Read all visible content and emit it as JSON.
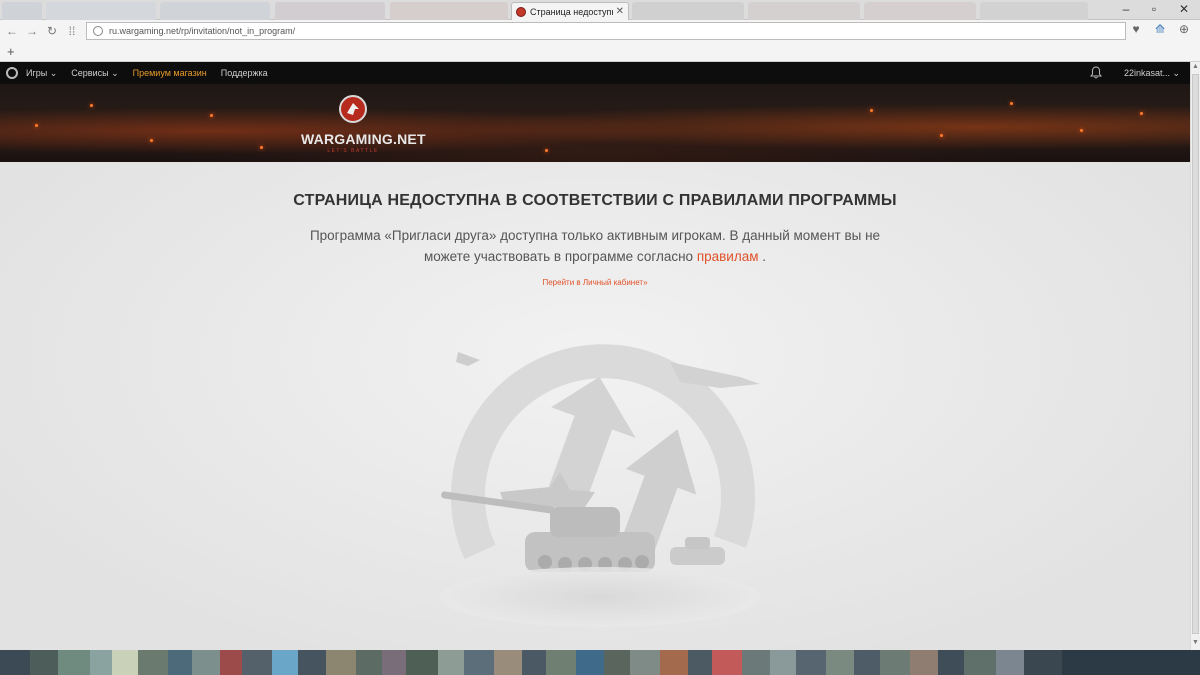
{
  "browser": {
    "active_tab_title": "Страница недоступна в",
    "address_url": "ru.wargaming.net/rp/invitation/not_in_program/"
  },
  "site_nav": {
    "items": [
      {
        "label": "Игры ⌄"
      },
      {
        "label": "Сервисы ⌄"
      },
      {
        "label": "Премиум магазин"
      },
      {
        "label": "Поддержка"
      }
    ],
    "username": "22inkasat... ⌄"
  },
  "banner": {
    "logo_name": "WARGAMING.NET",
    "logo_tagline": "LET'S BATTLE"
  },
  "content": {
    "headline": "СТРАНИЦА НЕДОСТУПНА В СООТВЕТСТВИИ С ПРАВИЛАМИ ПРОГРАММЫ",
    "desc_before": "Программа «Пригласи друга» доступна только активным игрокам. В данный момент вы не можете участвовать в программе согласно ",
    "desc_link": "правилам",
    "desc_after": " .",
    "cabinet_link": "Перейти в Личный кабинет»"
  },
  "colors": {
    "accent_orange": "#e0522a",
    "premium_gold": "#e89b2a",
    "nav_bg": "#0d0d0d"
  }
}
